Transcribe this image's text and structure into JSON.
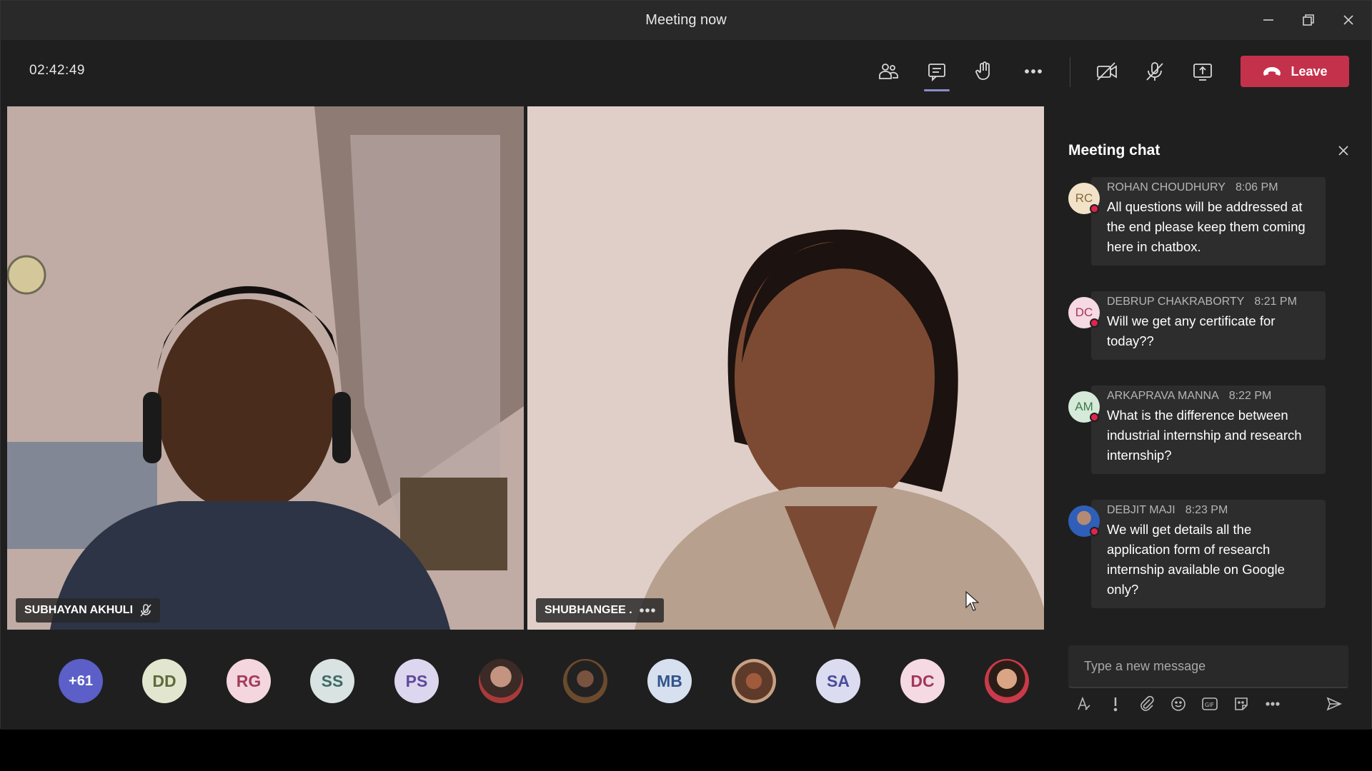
{
  "window": {
    "title": "Meeting now"
  },
  "toolbar": {
    "timer": "02:42:49",
    "leave_label": "Leave",
    "accent_color": "#8b8cc7",
    "leave_color": "#c4314b",
    "icons": [
      "participants-icon",
      "chat-icon",
      "raise-hand-icon",
      "more-options-icon",
      "camera-off-icon",
      "mic-off-icon",
      "share-screen-icon"
    ]
  },
  "videos": [
    {
      "name": "SUBHAYAN AKHULI",
      "muted_icon": "mic-muted-icon"
    },
    {
      "name": "SHUBHANGEE .",
      "more_icon": "more-dots-icon"
    }
  ],
  "participants": {
    "overflow": "+61",
    "avatars": [
      {
        "initials": "DD",
        "bg": "#e3e6cf",
        "fg": "#5e6b3a"
      },
      {
        "initials": "RG",
        "bg": "#f3d6de",
        "fg": "#a33d5b"
      },
      {
        "initials": "SS",
        "bg": "#d9e4e2",
        "fg": "#3e6b66"
      },
      {
        "initials": "PS",
        "bg": "#ddd6ef",
        "fg": "#5f4a9a"
      },
      {
        "initials": "",
        "photo": true
      },
      {
        "initials": "",
        "photo": true
      },
      {
        "initials": "MB",
        "bg": "#d6e0ef",
        "fg": "#34558c"
      },
      {
        "initials": "",
        "photo": true
      },
      {
        "initials": "SA",
        "bg": "#dcdcf1",
        "fg": "#4a4c9c"
      },
      {
        "initials": "DC",
        "bg": "#f5d9e3",
        "fg": "#a3365c"
      },
      {
        "initials": "",
        "photo": true
      }
    ]
  },
  "chat": {
    "header": "Meeting chat",
    "messages": [
      {
        "initials": "RC",
        "sender": "ROHAN CHOUDHURY",
        "time": "8:06 PM",
        "text": "All questions will be addressed at the end please keep them coming here in chatbox.",
        "av_bg": "#f1e2c8",
        "av_fg": "#8a6b3f"
      },
      {
        "initials": "DC",
        "sender": "DEBRUP CHAKRABORTY",
        "time": "8:21 PM",
        "text": "Will we get any certificate for today??",
        "av_bg": "#f5d9e3",
        "av_fg": "#a3365c"
      },
      {
        "initials": "AM",
        "sender": "ARKAPRAVA MANNA",
        "time": "8:22 PM",
        "text": "What is the difference between industrial internship and research internship?",
        "av_bg": "#d5ead9",
        "av_fg": "#3d7a4b"
      },
      {
        "initials": "",
        "sender": "DEBJIT MAJI",
        "time": "8:23 PM",
        "text": "We will get details all the application form of research internship available on Google only?",
        "av_bg": "#3a6fd0",
        "av_fg": "#ffffff"
      }
    ],
    "compose_placeholder": "Type a new message"
  }
}
